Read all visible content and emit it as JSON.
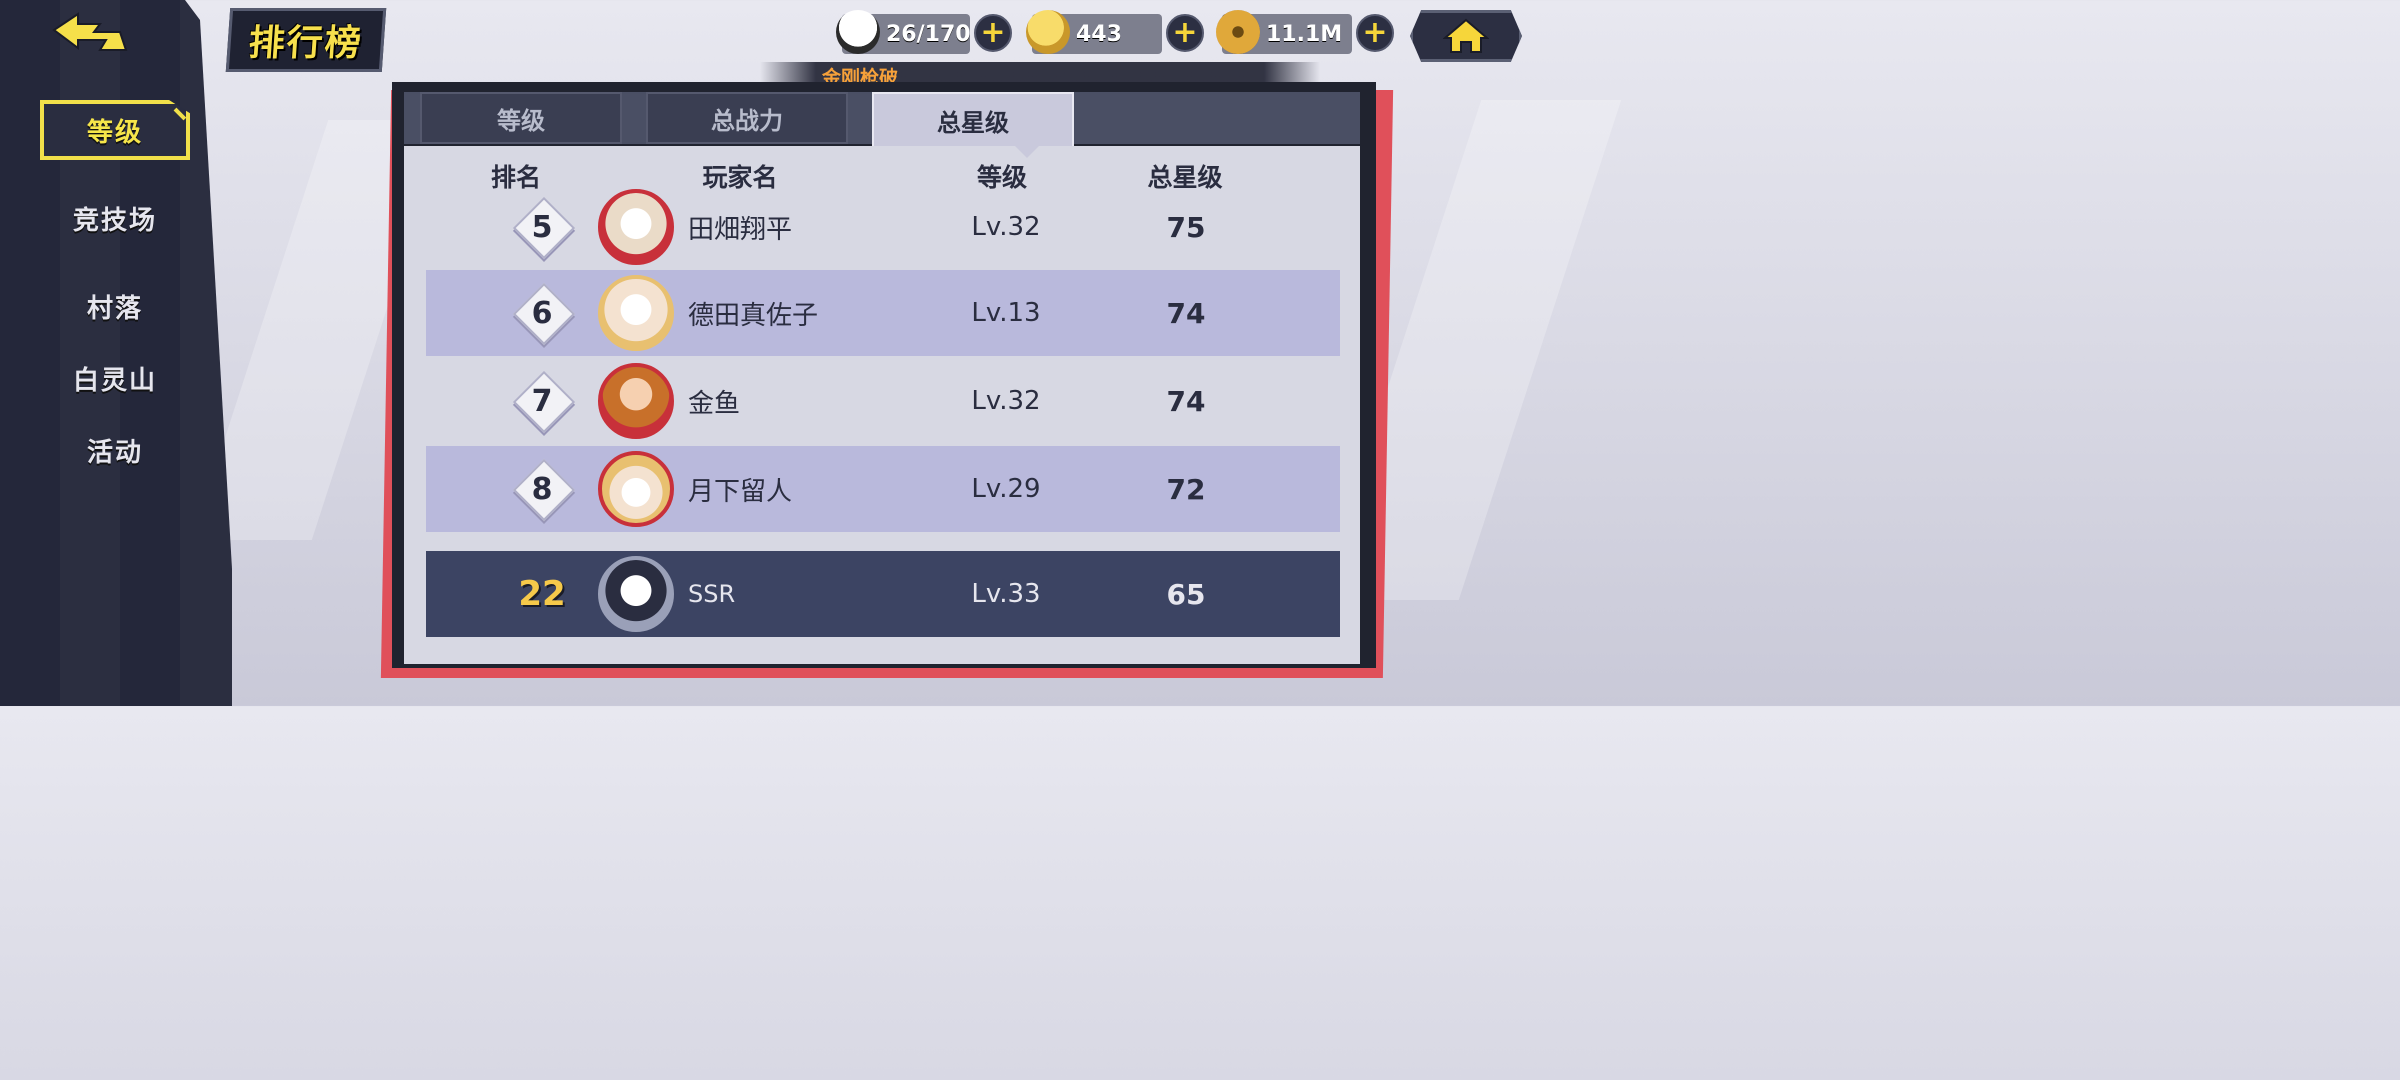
{
  "screen_title": "排行榜",
  "sidebar": {
    "items": [
      {
        "label": "等级",
        "active": true
      },
      {
        "label": "竞技场",
        "active": false
      },
      {
        "label": "村落",
        "active": false
      },
      {
        "label": "白灵山",
        "active": false
      },
      {
        "label": "活动",
        "active": false
      }
    ]
  },
  "resources": {
    "stamina": "26/170",
    "gold": "443",
    "coins": "11.1M"
  },
  "banner_text": "金刚枪破",
  "tabs": [
    {
      "label": "等级",
      "active": false
    },
    {
      "label": "总战力",
      "active": false
    },
    {
      "label": "总星级",
      "active": true
    }
  ],
  "columns": {
    "rank": "排名",
    "player": "玩家名",
    "level": "等级",
    "stars": "总星级"
  },
  "rows": [
    {
      "rank": "5",
      "name": "田畑翔平",
      "level": "Lv.32",
      "stars": "75"
    },
    {
      "rank": "6",
      "name": "德田真佐子",
      "level": "Lv.13",
      "stars": "74"
    },
    {
      "rank": "7",
      "name": "金鱼",
      "level": "Lv.32",
      "stars": "74"
    },
    {
      "rank": "8",
      "name": "月下留人",
      "level": "Lv.29",
      "stars": "72"
    }
  ],
  "self_row": {
    "rank": "22",
    "name": "SSR",
    "level": "Lv.33",
    "stars": "65"
  },
  "colors": {
    "accent_yellow": "#f1e04a",
    "panel_red": "#e0505a",
    "row_shade": "#b9b9dc",
    "self_row": "#3c4463"
  }
}
